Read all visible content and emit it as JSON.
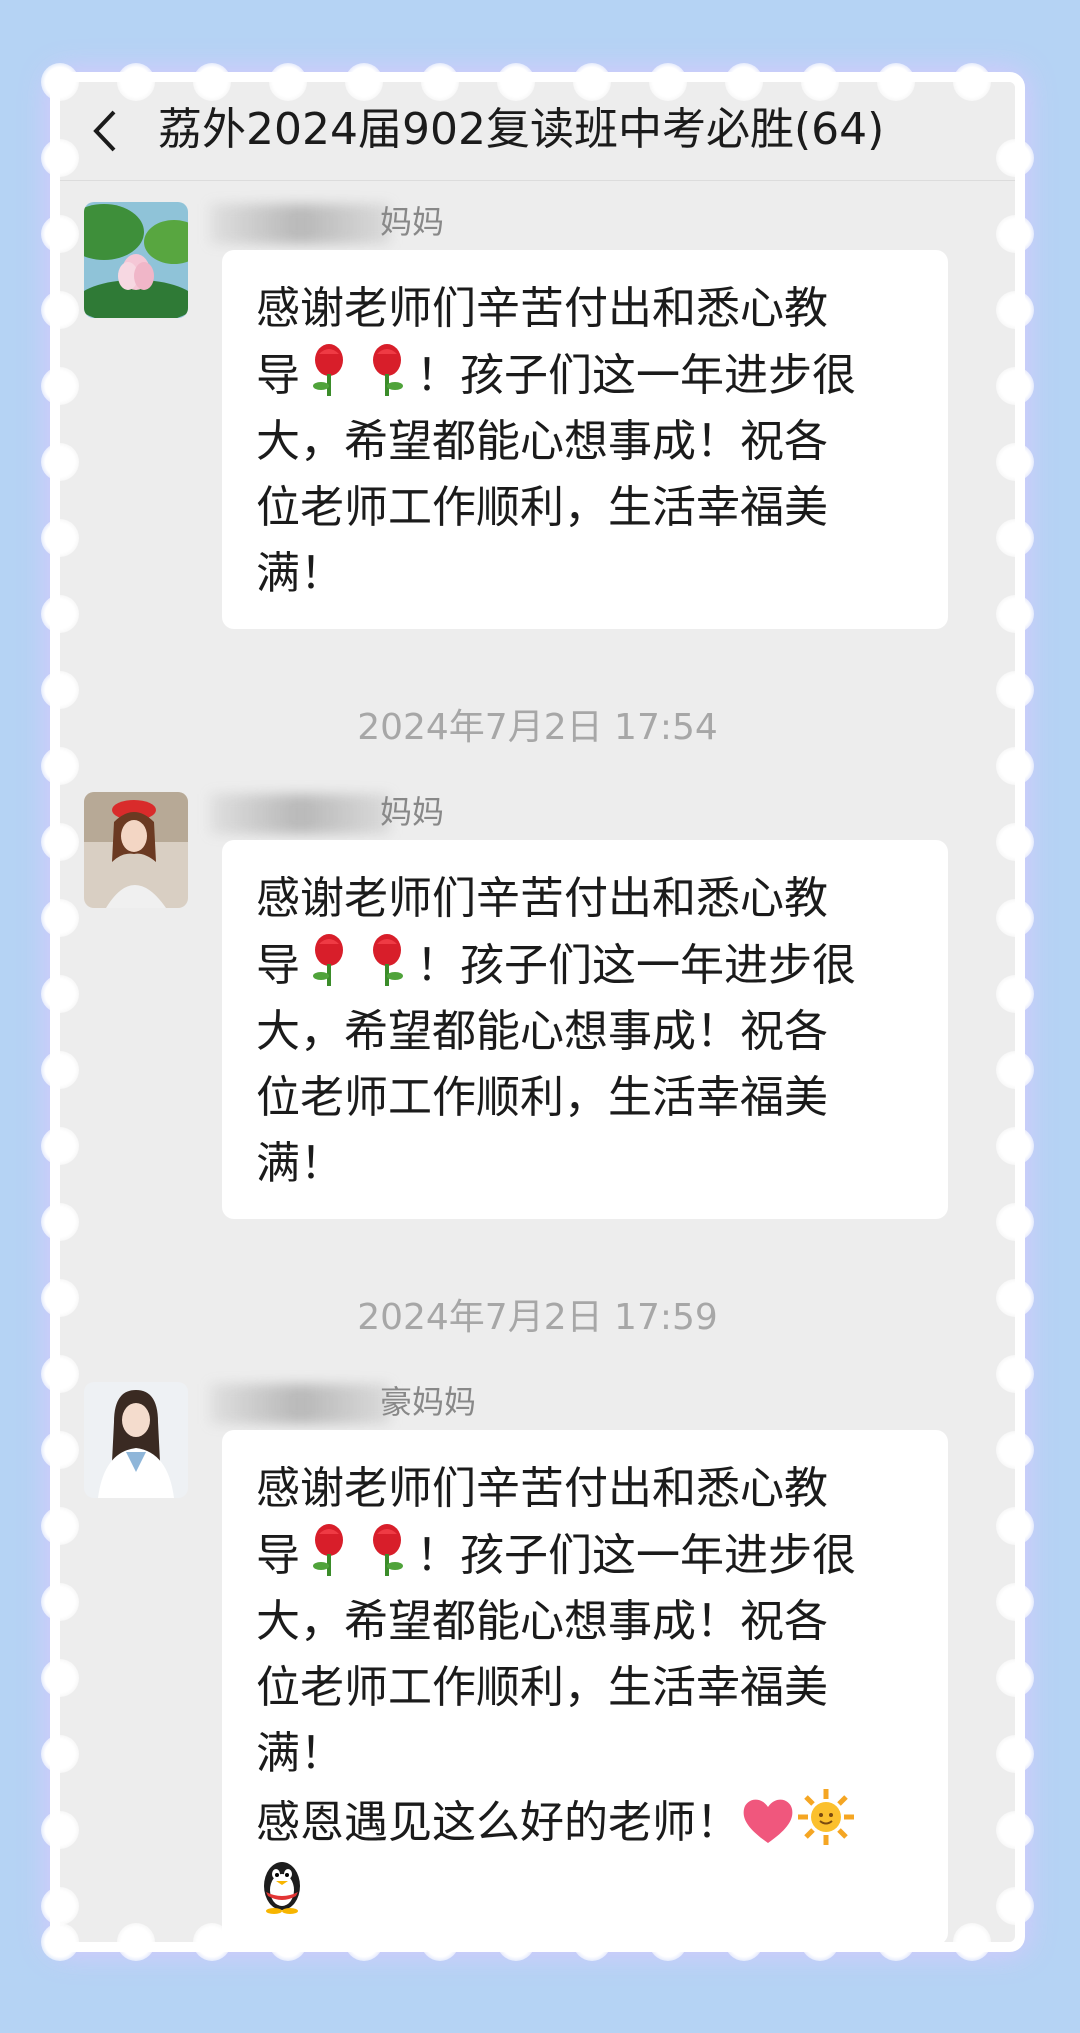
{
  "chat": {
    "title": "荔外2024届902复读班中考必胜(64)"
  },
  "messages": [
    {
      "sender_suffix": "妈妈",
      "lines": [
        "感谢老师们辛苦付出和悉心教",
        "导",
        "！孩子们这一年进步很",
        "大，希望都能心想事成！祝各",
        "位老师工作顺利，生活幸福美",
        "满！"
      ]
    },
    {
      "timestamp": "2024年7月2日 17:54",
      "sender_suffix": "妈妈",
      "lines": [
        "感谢老师们辛苦付出和悉心教",
        "导",
        "！孩子们这一年进步很",
        "大，希望都能心想事成！祝各",
        "位老师工作顺利，生活幸福美",
        "满！"
      ]
    },
    {
      "timestamp": "2024年7月2日 17:59",
      "sender_suffix": "豪妈妈",
      "lines": [
        "感谢老师们辛苦付出和悉心教",
        "导",
        "！孩子们这一年进步很",
        "大，希望都能心想事成！祝各",
        "位老师工作顺利，生活幸福美",
        "满！",
        "感恩遇见这么好的老师！"
      ]
    }
  ],
  "emoji": [
    "rose",
    "rose",
    "heart",
    "sun",
    "penguin"
  ],
  "colors": {
    "page_bg": "#b5d3f4",
    "chat_bg": "#ededed",
    "bubble": "#ffffff",
    "timestamp": "#a7a7a7"
  }
}
